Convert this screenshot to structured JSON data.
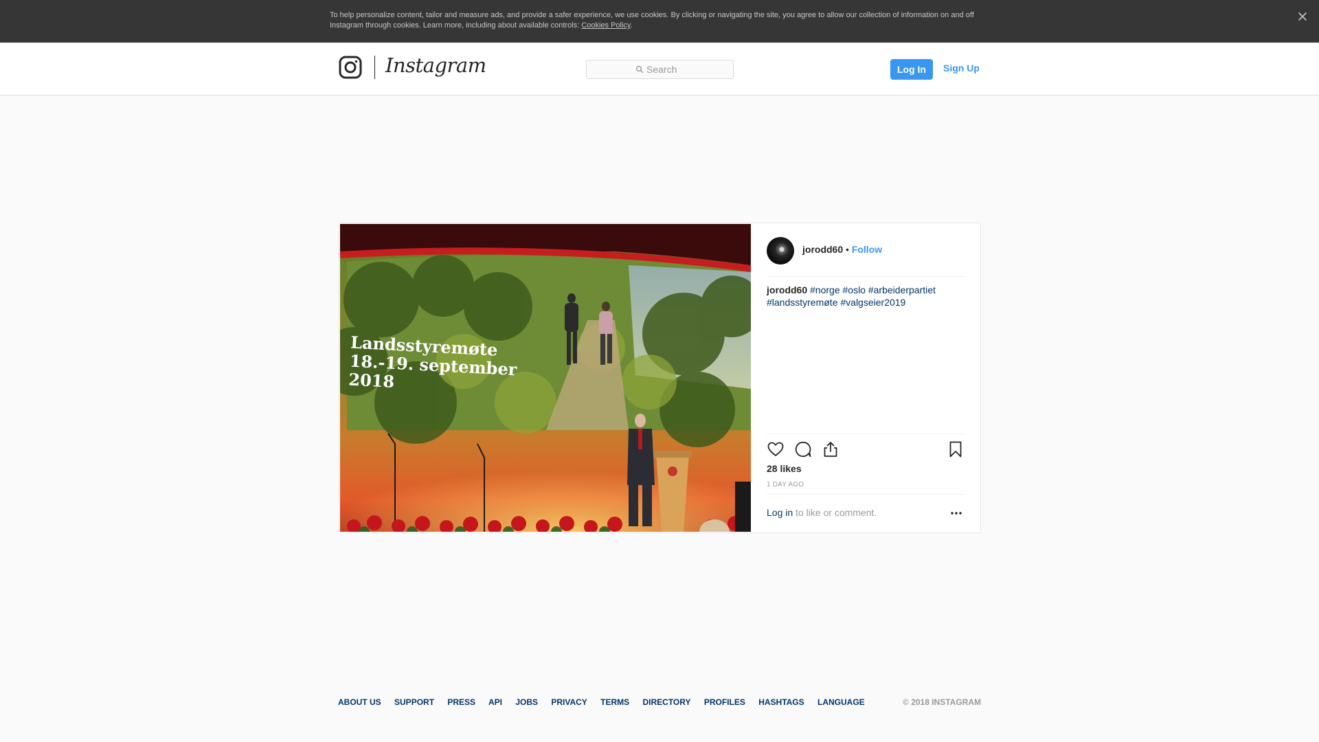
{
  "cookie_banner": {
    "text": "To help personalize content, tailor and measure ads, and provide a safer experience, we use cookies. By clicking or navigating the site, you agree to allow our collection of information on and off Instagram through cookies. Learn more, including about available controls: ",
    "link_label": "Cookies Policy",
    "tail": ".",
    "close_icon": "close-icon"
  },
  "header": {
    "logo_icon": "instagram-glyph-icon",
    "logo_text": "Instagram",
    "search_placeholder": "Search",
    "login_label": "Log In",
    "signup_label": "Sign Up"
  },
  "post": {
    "photo": {
      "slide_title_line1": "Landsstyremøte",
      "slide_title_line2": "18.-19. september",
      "slide_title_line3": "2018"
    },
    "author": "jorodd60",
    "separator": "•",
    "follow_label": "Follow",
    "caption_user": "jorodd60",
    "hashtags": [
      "#norge",
      "#oslo",
      "#arbeiderpartiet",
      "#landsstyremøte",
      "#valgseier2019"
    ],
    "actions": [
      "heart-icon",
      "comment-icon",
      "share-icon",
      "bookmark-icon"
    ],
    "likes": "28 likes",
    "time_ago": "1 day ago",
    "login_prompt_link": "Log in",
    "login_prompt_rest": " to like or comment.",
    "more_icon": "more-options-icon"
  },
  "footer": {
    "links": [
      "About us",
      "Support",
      "Press",
      "API",
      "Jobs",
      "Privacy",
      "Terms",
      "Directory",
      "Profiles",
      "Hashtags",
      "Language"
    ],
    "copyright": "© 2018 Instagram"
  }
}
